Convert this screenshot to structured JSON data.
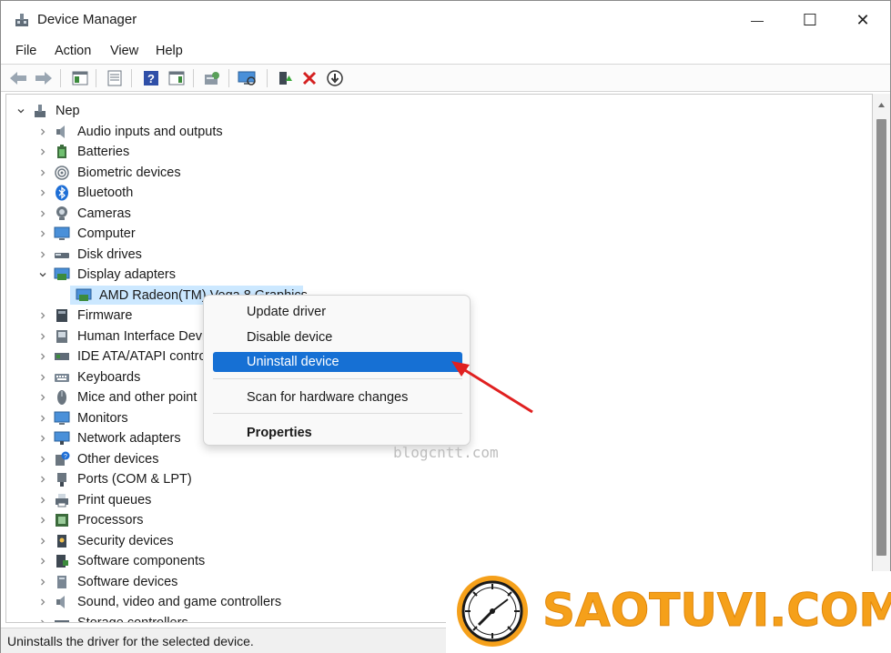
{
  "window": {
    "title": "Device Manager",
    "controls": {
      "minimize": "—",
      "maximize": "☐",
      "close": "✕"
    }
  },
  "menu": [
    "File",
    "Action",
    "View",
    "Help"
  ],
  "toolbar_icons": [
    "back-icon",
    "forward-icon",
    "console-tree-icon",
    "properties-sheet-icon",
    "help-icon",
    "action-pane-icon",
    "update-driver-icon",
    "scan-hardware-icon",
    "enable-device-icon",
    "uninstall-device-icon",
    "disable-device-icon"
  ],
  "tree": {
    "root": "Nep",
    "categories": [
      {
        "label": "Audio inputs and outputs",
        "icon": "speaker-icon"
      },
      {
        "label": "Batteries",
        "icon": "battery-icon"
      },
      {
        "label": "Biometric devices",
        "icon": "fingerprint-icon"
      },
      {
        "label": "Bluetooth",
        "icon": "bluetooth-icon"
      },
      {
        "label": "Cameras",
        "icon": "camera-icon"
      },
      {
        "label": "Computer",
        "icon": "computer-icon"
      },
      {
        "label": "Disk drives",
        "icon": "disk-drive-icon"
      },
      {
        "label": "Display adapters",
        "icon": "display-adapter-icon",
        "expanded": true
      },
      {
        "label": "Firmware",
        "icon": "firmware-icon"
      },
      {
        "label": "Human Interface Devi",
        "icon": "hid-icon"
      },
      {
        "label": "IDE ATA/ATAPI controll",
        "icon": "ide-controller-icon"
      },
      {
        "label": "Keyboards",
        "icon": "keyboard-icon"
      },
      {
        "label": "Mice and other point",
        "icon": "mouse-icon"
      },
      {
        "label": "Monitors",
        "icon": "monitor-icon"
      },
      {
        "label": "Network adapters",
        "icon": "network-adapter-icon"
      },
      {
        "label": "Other devices",
        "icon": "other-devices-icon"
      },
      {
        "label": "Ports (COM & LPT)",
        "icon": "port-icon"
      },
      {
        "label": "Print queues",
        "icon": "printer-icon"
      },
      {
        "label": "Processors",
        "icon": "processor-icon"
      },
      {
        "label": "Security devices",
        "icon": "security-device-icon"
      },
      {
        "label": "Software components",
        "icon": "software-component-icon"
      },
      {
        "label": "Software devices",
        "icon": "software-device-icon"
      },
      {
        "label": "Sound, video and game controllers",
        "icon": "sound-icon"
      },
      {
        "label": "Storage controllers",
        "icon": "storage-controller-icon"
      }
    ],
    "selected_device": "AMD Radeon(TM) Vega 8 Graphics"
  },
  "context_menu": {
    "items": [
      {
        "label": "Update driver"
      },
      {
        "label": "Disable device"
      },
      {
        "label": "Uninstall device",
        "highlighted": true
      },
      {
        "label": "Scan for hardware changes"
      },
      {
        "label": "Properties",
        "bold": true
      }
    ]
  },
  "status_bar": {
    "text": "Uninstalls the driver for the selected device."
  },
  "watermarks": {
    "small": "blogcntt.com",
    "brand": "SAOTUVI.COM"
  },
  "colors": {
    "accent": "#1670d4",
    "selection": "#cce8ff",
    "brand": "#f5a01a",
    "arrow": "#e02020"
  }
}
